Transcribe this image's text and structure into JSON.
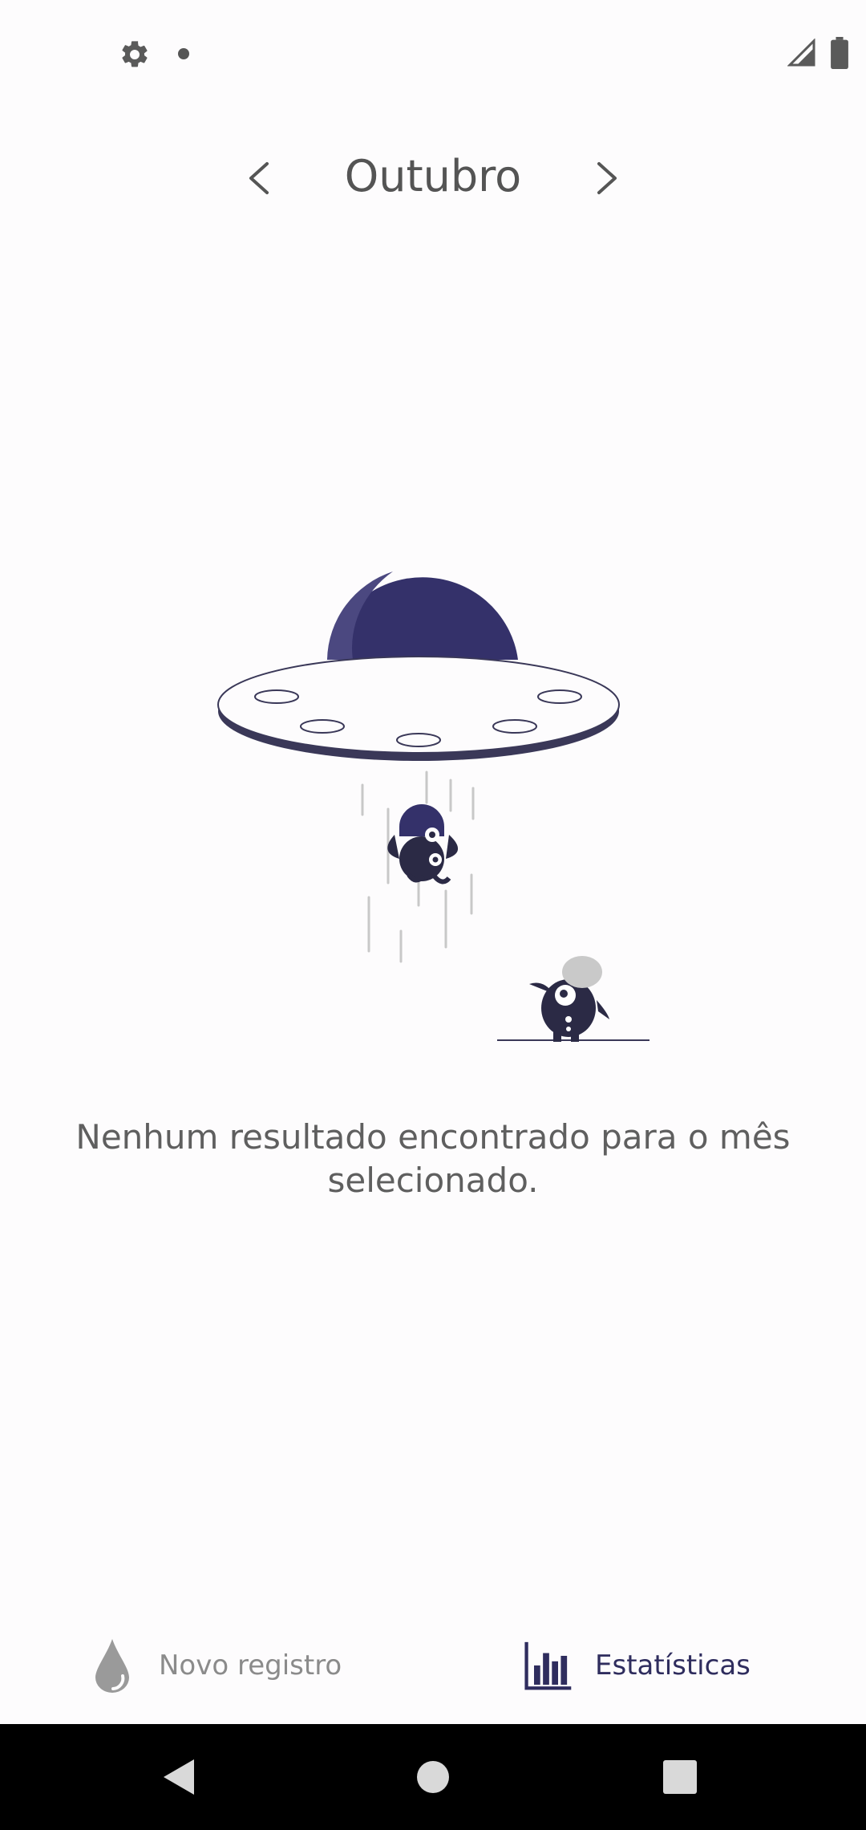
{
  "status_bar": {
    "left_icons": [
      "gear-icon",
      "notification-dot"
    ],
    "right_icons": [
      "signal-icon",
      "battery-icon"
    ]
  },
  "month_nav": {
    "title": "Outubro",
    "prev_icon": "chevron-left-icon",
    "next_icon": "chevron-right-icon"
  },
  "illustration": {
    "description_icon": "ufo-abduction-illustration",
    "accent_color": "#34316a"
  },
  "empty_state": {
    "message": "Nenhum resultado encontrado para o mês selecionado."
  },
  "bottom_nav": {
    "items": [
      {
        "label": "Novo registro",
        "icon": "drop-icon",
        "active": false
      },
      {
        "label": "Estatísticas",
        "icon": "bar-chart-icon",
        "active": true
      }
    ]
  },
  "system_nav": {
    "icons": [
      "back-icon",
      "home-icon",
      "recents-icon"
    ]
  },
  "colors": {
    "background": "#fdfcfd",
    "accent": "#34316a",
    "text": "#555555",
    "inactive": "#8b8b8b"
  }
}
